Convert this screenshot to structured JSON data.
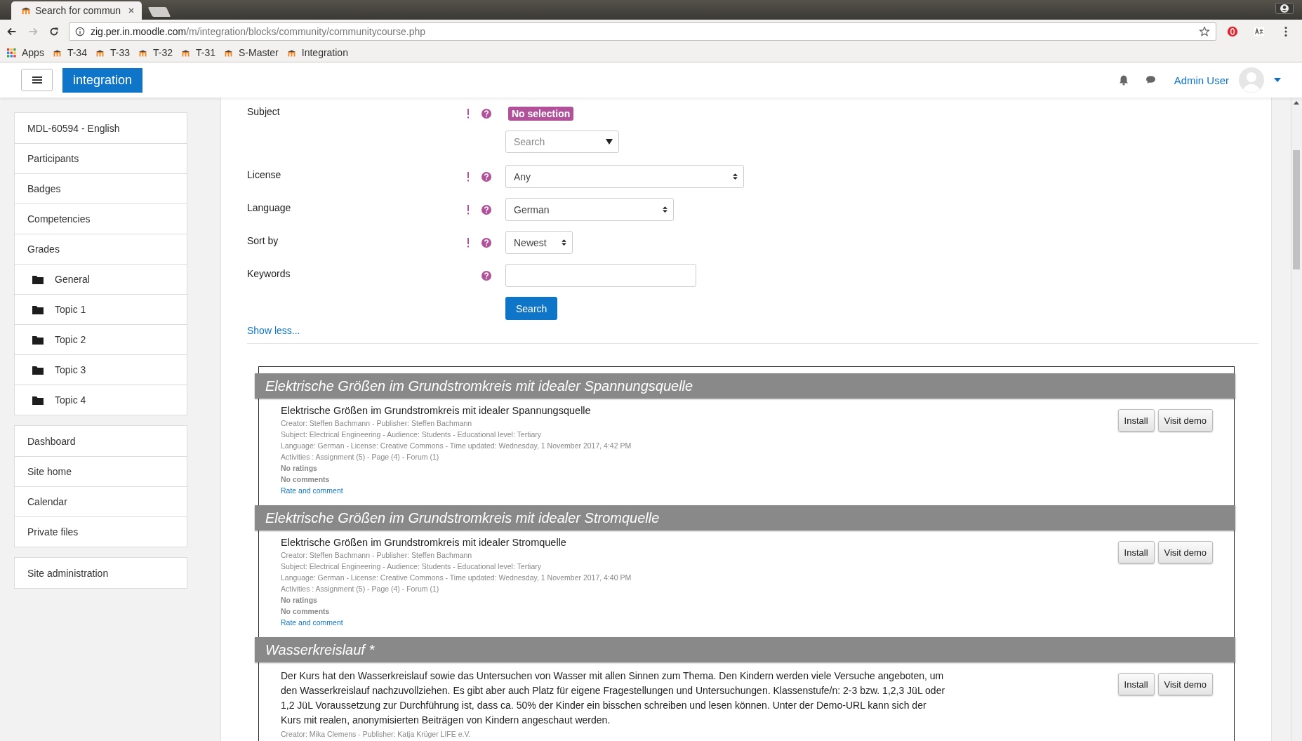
{
  "browser": {
    "tab_title": "Search for commun",
    "url_host": "zig.per.in.moodle.com",
    "url_path": "/m/integration/blocks/community/communitycourse.php",
    "bookmarks": [
      {
        "label": "Apps",
        "kind": "apps"
      },
      {
        "label": "T-34",
        "kind": "moodle"
      },
      {
        "label": "T-33",
        "kind": "moodle"
      },
      {
        "label": "T-32",
        "kind": "moodle"
      },
      {
        "label": "T-31",
        "kind": "moodle"
      },
      {
        "label": "S-Master",
        "kind": "moodle"
      },
      {
        "label": "Integration",
        "kind": "moodle"
      }
    ]
  },
  "navbar": {
    "site_name": "integration",
    "user_name": "Admin User"
  },
  "sidebar": {
    "groups": [
      [
        {
          "label": "MDL-60594 - English",
          "kind": "link"
        },
        {
          "label": "Participants",
          "kind": "link"
        },
        {
          "label": "Badges",
          "kind": "link"
        },
        {
          "label": "Competencies",
          "kind": "link"
        },
        {
          "label": "Grades",
          "kind": "link"
        },
        {
          "label": "General",
          "kind": "folder"
        },
        {
          "label": "Topic 1",
          "kind": "folder"
        },
        {
          "label": "Topic 2",
          "kind": "folder"
        },
        {
          "label": "Topic 3",
          "kind": "folder"
        },
        {
          "label": "Topic 4",
          "kind": "folder"
        }
      ],
      [
        {
          "label": "Dashboard",
          "kind": "link"
        },
        {
          "label": "Site home",
          "kind": "link"
        },
        {
          "label": "Calendar",
          "kind": "link"
        },
        {
          "label": "Private files",
          "kind": "link"
        }
      ],
      [
        {
          "label": "Site administration",
          "kind": "link"
        }
      ]
    ]
  },
  "form": {
    "fields": [
      {
        "label": "Subject",
        "kind": "tags",
        "required": true,
        "tag": "No selection",
        "placeholder": "Search"
      },
      {
        "label": "License",
        "kind": "select",
        "required": true,
        "value": "Any"
      },
      {
        "label": "Language",
        "kind": "select",
        "required": true,
        "value": "German"
      },
      {
        "label": "Sort by",
        "kind": "select",
        "required": true,
        "value": "Newest"
      },
      {
        "label": "Keywords",
        "kind": "text",
        "required": false
      }
    ],
    "submit": "Search",
    "toggle_link": "Show less..."
  },
  "courses": [
    {
      "heading": "Elektrische Größen im Grundstromkreis mit idealer Spannungsquelle",
      "title": "Elektrische Größen im Grundstromkreis mit idealer Spannungsquelle",
      "meta": [
        "Creator: Steffen Bachmann - Publisher: Steffen Bachmann",
        "Subject: Electrical Engineering - Audience: Students - Educational level: Tertiary",
        "Language: German - License: Creative Commons - Time updated: Wednesday, 1 November 2017, 4:42 PM",
        "Activities : Assignment (5) - Page (4) - Forum (1)"
      ],
      "ratings": "No ratings",
      "comments": "No comments",
      "rate_link": "Rate and comment",
      "buttons": [
        "Install",
        "Visit demo"
      ]
    },
    {
      "heading": "Elektrische Größen im Grundstromkreis mit idealer Stromquelle",
      "title": "Elektrische Größen im Grundstromkreis mit idealer Stromquelle",
      "meta": [
        "Creator: Steffen Bachmann - Publisher: Steffen Bachmann",
        "Subject: Electrical Engineering - Audience: Students - Educational level: Tertiary",
        "Language: German - License: Creative Commons - Time updated: Wednesday, 1 November 2017, 4:40 PM",
        "Activities : Assignment (5) - Page (4) - Forum (1)"
      ],
      "ratings": "No ratings",
      "comments": "No comments",
      "rate_link": "Rate and comment",
      "buttons": [
        "Install",
        "Visit demo"
      ]
    },
    {
      "heading": "Wasserkreislauf *",
      "description": "Der Kurs hat den Wasserkreislauf sowie das Untersuchen von Wasser mit allen Sinnen zum Thema. Den Kindern werden viele Versuche angeboten, um den Wasserkreislauf nachzuvollziehen. Es gibt aber auch Platz für eigene Fragestellungen und Untersuchungen. Klassenstufe/n: 2-3 bzw. 1,2,3 JüL oder 1,2 JüL Voraussetzung zur Durchführung ist, dass ca. 50% der Kinder ein bisschen schreiben und lesen können. Unter der Demo-URL kann sich der Kurs mit realen, anonymisierten Beiträgen von Kindern angeschaut werden.",
      "meta": [
        "Creator: Mika Clemens - Publisher: Katja Krüger LIFE e.V."
      ],
      "buttons": [
        "Install",
        "Visit demo"
      ]
    }
  ]
}
